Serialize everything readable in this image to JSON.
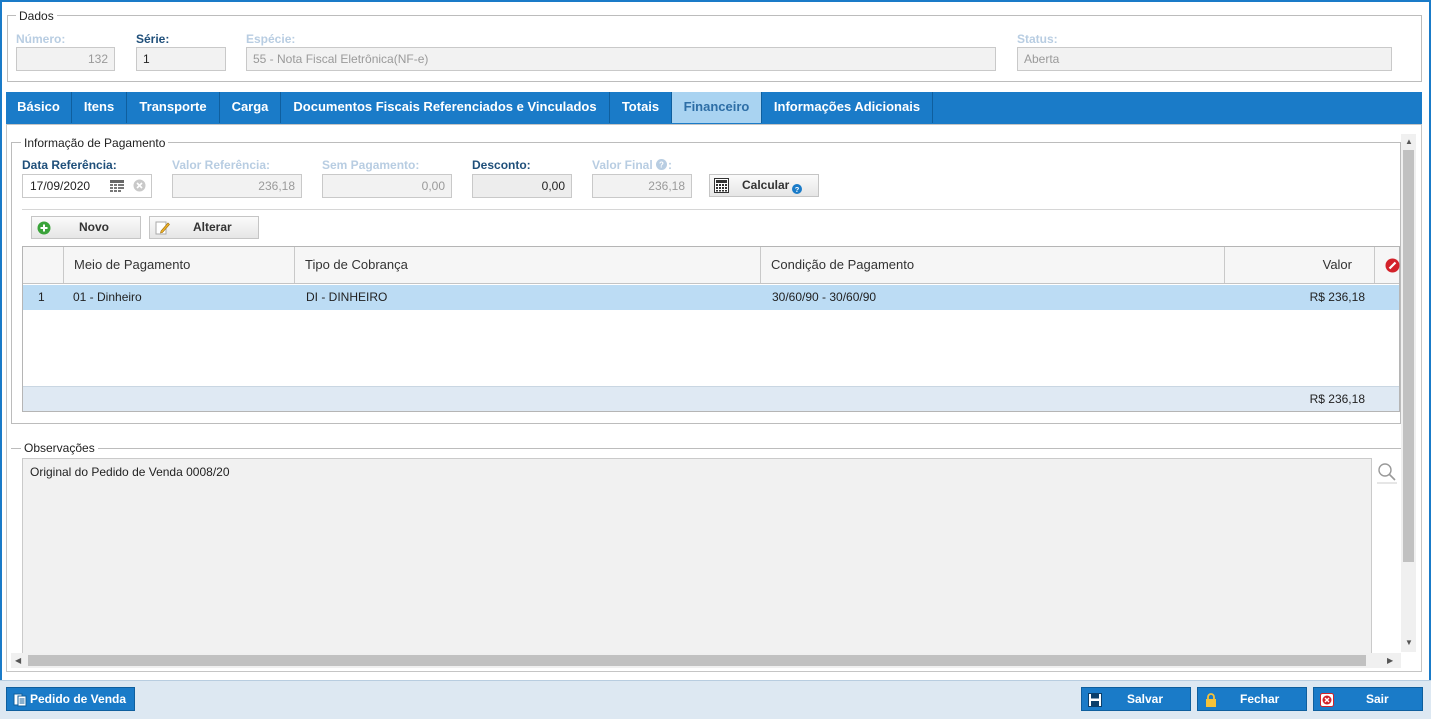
{
  "dados": {
    "legend": "Dados",
    "numero_label": "Número:",
    "numero_value": "132",
    "serie_label": "Série:",
    "serie_value": "1",
    "especie_label": "Espécie:",
    "especie_value": "55 - Nota Fiscal Eletrônica(NF-e)",
    "status_label": "Status:",
    "status_value": "Aberta"
  },
  "tabs": [
    {
      "label": "Básico"
    },
    {
      "label": "Itens"
    },
    {
      "label": "Transporte"
    },
    {
      "label": "Carga"
    },
    {
      "label": "Documentos Fiscais Referenciados e Vinculados"
    },
    {
      "label": "Totais"
    },
    {
      "label": "Financeiro",
      "active": true
    },
    {
      "label": "Informações Adicionais"
    }
  ],
  "pagamento": {
    "legend": "Informação de Pagamento",
    "data_ref_label": "Data Referência:",
    "data_ref_value": "17/09/2020",
    "valor_ref_label": "Valor Referência:",
    "valor_ref_value": "236,18",
    "sem_pag_label": "Sem Pagamento:",
    "sem_pag_value": "0,00",
    "desconto_label": "Desconto:",
    "desconto_value": "0,00",
    "valor_final_label": "Valor Final",
    "valor_final_value": "236,18",
    "calcular_label": "Calcular",
    "novo_label": "Novo",
    "alterar_label": "Alterar"
  },
  "grid": {
    "columns": [
      "Meio de Pagamento",
      "Tipo de Cobrança",
      "Condição de Pagamento",
      "Valor"
    ],
    "rows": [
      {
        "num": "1",
        "meio": "01 - Dinheiro",
        "tipo": "DI - DINHEIRO",
        "condicao": "30/60/90 - 30/60/90",
        "valor": "R$ 236,18"
      }
    ],
    "total": "R$ 236,18"
  },
  "observacoes": {
    "legend": "Observações",
    "text": "Original do Pedido de Venda 0008/20"
  },
  "footer": {
    "pedido_label": "Pedido de Venda",
    "salvar_label": "Salvar",
    "fechar_label": "Fechar",
    "sair_label": "Sair"
  },
  "colors": {
    "primary": "#1a7bc8",
    "tab_active_bg": "#a9d3f1",
    "selected_row": "#bcdcf4",
    "label_active": "#1f4f7a",
    "label_disabled": "#b8cde2"
  }
}
